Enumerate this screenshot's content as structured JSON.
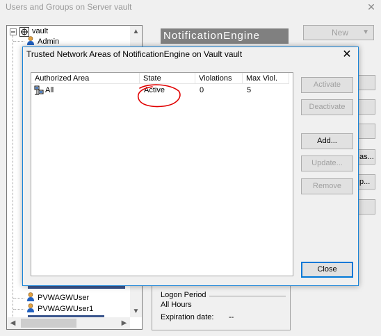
{
  "outer_window": {
    "title": "Users and Groups on Server vault",
    "close_glyph": "✕",
    "tree": {
      "root_label": "vault",
      "items_top": [
        "Admin"
      ],
      "items_bottom": [
        "PVWAGWUser",
        "PVWAGWUser1"
      ]
    },
    "header_label": "NotificationEngine",
    "new_button": "New",
    "side_button_partials": [
      "as...",
      "p..."
    ],
    "lower_panel": {
      "logon_period_label": "Logon Period",
      "logon_period_value": "All Hours",
      "expiration_label": "Expiration date:",
      "expiration_value": "--"
    }
  },
  "dialog": {
    "title": "Trusted Network Areas of NotificationEngine on Vault vault",
    "close_glyph": "✕",
    "columns": [
      "Authorized Area",
      "State",
      "Violations",
      "Max Viol."
    ],
    "rows": [
      {
        "area": "All",
        "state": "Active",
        "violations": "0",
        "max_viol": "5"
      }
    ],
    "buttons": {
      "activate": "Activate",
      "deactivate": "Deactivate",
      "add": "Add...",
      "update": "Update...",
      "remove": "Remove",
      "close": "Close"
    }
  },
  "colors": {
    "dialog_border": "#1883d7",
    "annotation": "#e00000",
    "header_bg": "#808080"
  },
  "icons": [
    "tree-collapse-icon",
    "server-icon",
    "user-icon",
    "network-area-icon",
    "chevron-up-icon",
    "chevron-down-icon",
    "chevron-left-icon",
    "chevron-right-icon",
    "dropdown-arrow-icon",
    "close-icon"
  ]
}
